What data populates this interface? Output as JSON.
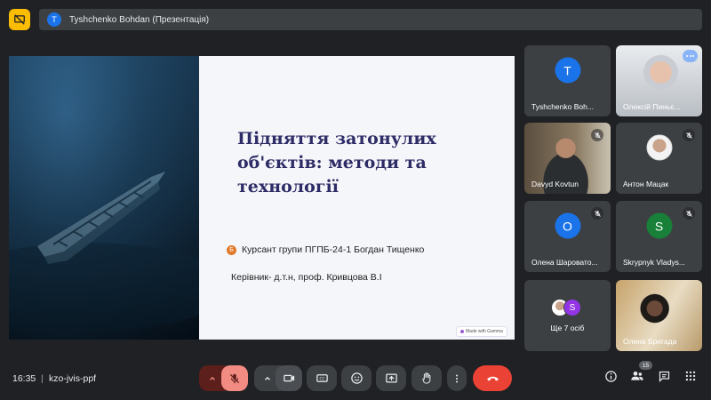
{
  "presentation": {
    "avatar_letter": "T",
    "label": "Tyshchenko Bohdan (Презентація)"
  },
  "slide": {
    "title": "Підняття затонулих об'єктів: методи та технології",
    "author_badge": "Б",
    "author": "Курсант групи ПГПБ-24-1 Богдан Тищенко",
    "advisor": "Керівник- д.т.н, проф. Кривцова В.І",
    "badge": "Made with Gamma"
  },
  "participants": [
    {
      "name": "Tyshchenko Boh...",
      "letter": "T",
      "color": "#1a73e8",
      "muted": false,
      "video": false
    },
    {
      "name": "Олексій Пиньє...",
      "letter": "",
      "color": "",
      "muted": false,
      "video": true
    },
    {
      "name": "Davyd Kovtun",
      "letter": "",
      "color": "",
      "muted": true,
      "video": true
    },
    {
      "name": "Антон Мацак",
      "letter": "",
      "color": "",
      "muted": true,
      "video": false
    },
    {
      "name": "Олена Шаровато...",
      "letter": "О",
      "color": "#1a73e8",
      "muted": true,
      "video": false
    },
    {
      "name": "Skrypnyk Vladys...",
      "letter": "S",
      "color": "#188038",
      "muted": true,
      "video": false
    },
    {
      "name": "Ще 7 осіб",
      "letter": "S",
      "color": "#9334e6",
      "muted": false,
      "video": false
    },
    {
      "name": "Олена Бригада",
      "letter": "",
      "color": "",
      "muted": false,
      "video": true
    }
  ],
  "meeting": {
    "time": "16:35",
    "separator": "|",
    "code": "kzo-jvis-ppf",
    "people_count": "15"
  },
  "colors": {
    "background": "#202124",
    "tile": "#3c4043",
    "danger": "#ea4335",
    "mic_off": "#f28b82",
    "slide_title": "#2e2c66"
  }
}
